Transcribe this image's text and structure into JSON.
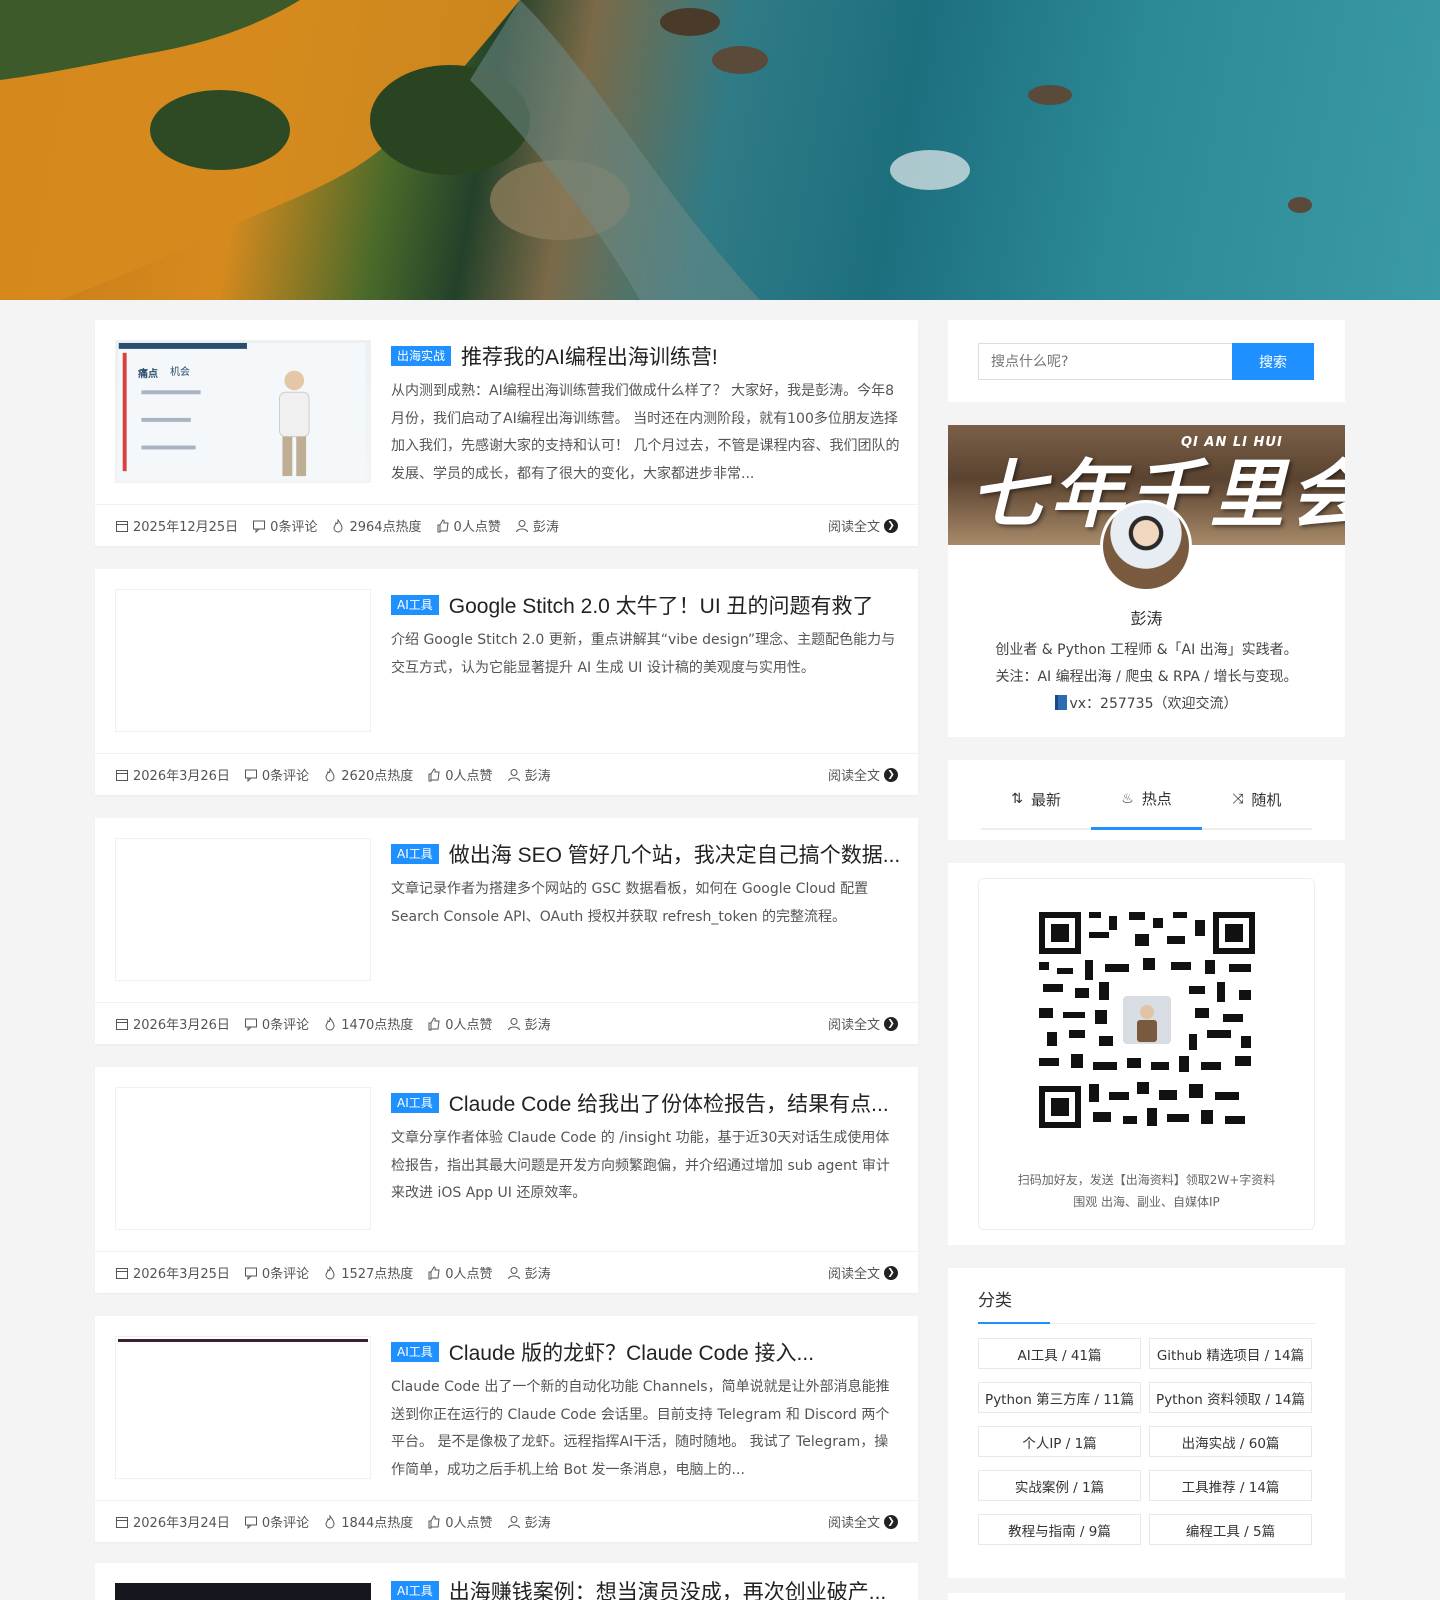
{
  "search": {
    "placeholder": "搜点什么呢?",
    "button": "搜索"
  },
  "posts": [
    {
      "tag": "出海实战",
      "title": "推荐我的AI编程出海训练营!",
      "excerpt": "从内测到成熟：AI编程出海训练营我们做成什么样了？ 大家好，我是彭涛。今年8月份，我们启动了AI编程出海训练营。 当时还在内测阶段，就有100多位朋友选择加入我们，先感谢大家的支持和认可！ 几个月过去，不管是课程内容、我们团队的发展、学员的成长，都有了很大的变化，大家都进步非常...",
      "date": "2025年12月25日",
      "comments": "0条评论",
      "hot": "2964点热度",
      "likes": "0人点赞",
      "author": "彭涛",
      "read": "阅读全文",
      "thumb_labels": [
        "痛点",
        "机会"
      ]
    },
    {
      "tag": "AI工具",
      "title": "Google Stitch 2.0 太牛了！UI 丑的问题有救了",
      "excerpt": "介绍 Google Stitch 2.0 更新，重点讲解其“vibe design”理念、主题配色能力与交互方式，认为它能显著提升 AI 生成 UI 设计稿的美观度与实用性。",
      "date": "2026年3月26日",
      "comments": "0条评论",
      "hot": "2620点热度",
      "likes": "0人点赞",
      "author": "彭涛",
      "read": "阅读全文"
    },
    {
      "tag": "AI工具",
      "title": "做出海 SEO 管好几个站，我决定自己搞个数据...",
      "excerpt": "文章记录作者为搭建多个网站的 GSC 数据看板，如何在 Google Cloud 配置 Search Console API、OAuth 授权并获取 refresh_token 的完整流程。",
      "date": "2026年3月26日",
      "comments": "0条评论",
      "hot": "1470点热度",
      "likes": "0人点赞",
      "author": "彭涛",
      "read": "阅读全文"
    },
    {
      "tag": "AI工具",
      "title": "Claude Code 给我出了份体检报告，结果有点...",
      "excerpt": "文章分享作者体验 Claude Code 的 /insight 功能，基于近30天对话生成使用体检报告，指出其最大问题是开发方向频繁跑偏，并介绍通过增加 sub agent 审计来改进 iOS App UI 还原效率。",
      "date": "2026年3月25日",
      "comments": "0条评论",
      "hot": "1527点热度",
      "likes": "0人点赞",
      "author": "彭涛",
      "read": "阅读全文"
    },
    {
      "tag": "AI工具",
      "title": "Claude 版的龙虾？Claude Code 接入...",
      "excerpt": "Claude Code 出了一个新的自动化功能 Channels，简单说就是让外部消息能推送到你正在运行的 Claude Code 会话里。目前支持 Telegram 和 Discord 两个平台。 是不是像极了龙虾。远程指挥AI干活，随时随地。 我试了 Telegram，操作简单，成功之后手机上给 Bot 发一条消息，电脑上的...",
      "date": "2026年3月24日",
      "comments": "0条评论",
      "hot": "1844点热度",
      "likes": "0人点赞",
      "author": "彭涛",
      "read": "阅读全文"
    }
  ],
  "peek": {
    "tag": "AI工具",
    "title": "出海赚钱案例：想当演员没成，再次创业破产..."
  },
  "profile": {
    "banner_title": "七年千里会",
    "banner_sub": "QI AN LI HUI",
    "name": "彭涛",
    "line1": "创业者 & Python 工程师 &「AI 出海」实践者。",
    "line2": "关注：AI 编程出海 / 爬虫 & RPA / 增长与变现。",
    "line3": "vx：257735（欢迎交流）"
  },
  "tabs": [
    {
      "icon": "sort-icon",
      "glyph": "⇅",
      "label": "最新",
      "active": false
    },
    {
      "icon": "fire-icon",
      "glyph": "♨",
      "label": "热点",
      "active": true
    },
    {
      "icon": "shuffle-icon",
      "glyph": "⤨",
      "label": "随机",
      "active": false
    }
  ],
  "qr": {
    "line1": "扫码加好友，发送【出海资料】领取2W+字资料",
    "line2": "围观 出海、副业、自媒体IP"
  },
  "categories": {
    "title": "分类",
    "items": [
      "AI工具 / 41篇",
      "Github 精选项目 / 14篇",
      "Python 第三方库 / 11篇",
      "Python 资料领取 / 14篇",
      "个人IP / 1篇",
      "出海实战 / 60篇",
      "实战案例 / 1篇",
      "工具推荐 / 14篇",
      "教程与指南 / 9篇",
      "编程工具 / 5篇"
    ]
  },
  "colors": {
    "accent": "#1e90ff",
    "page_bg": "#f4f4f4"
  }
}
